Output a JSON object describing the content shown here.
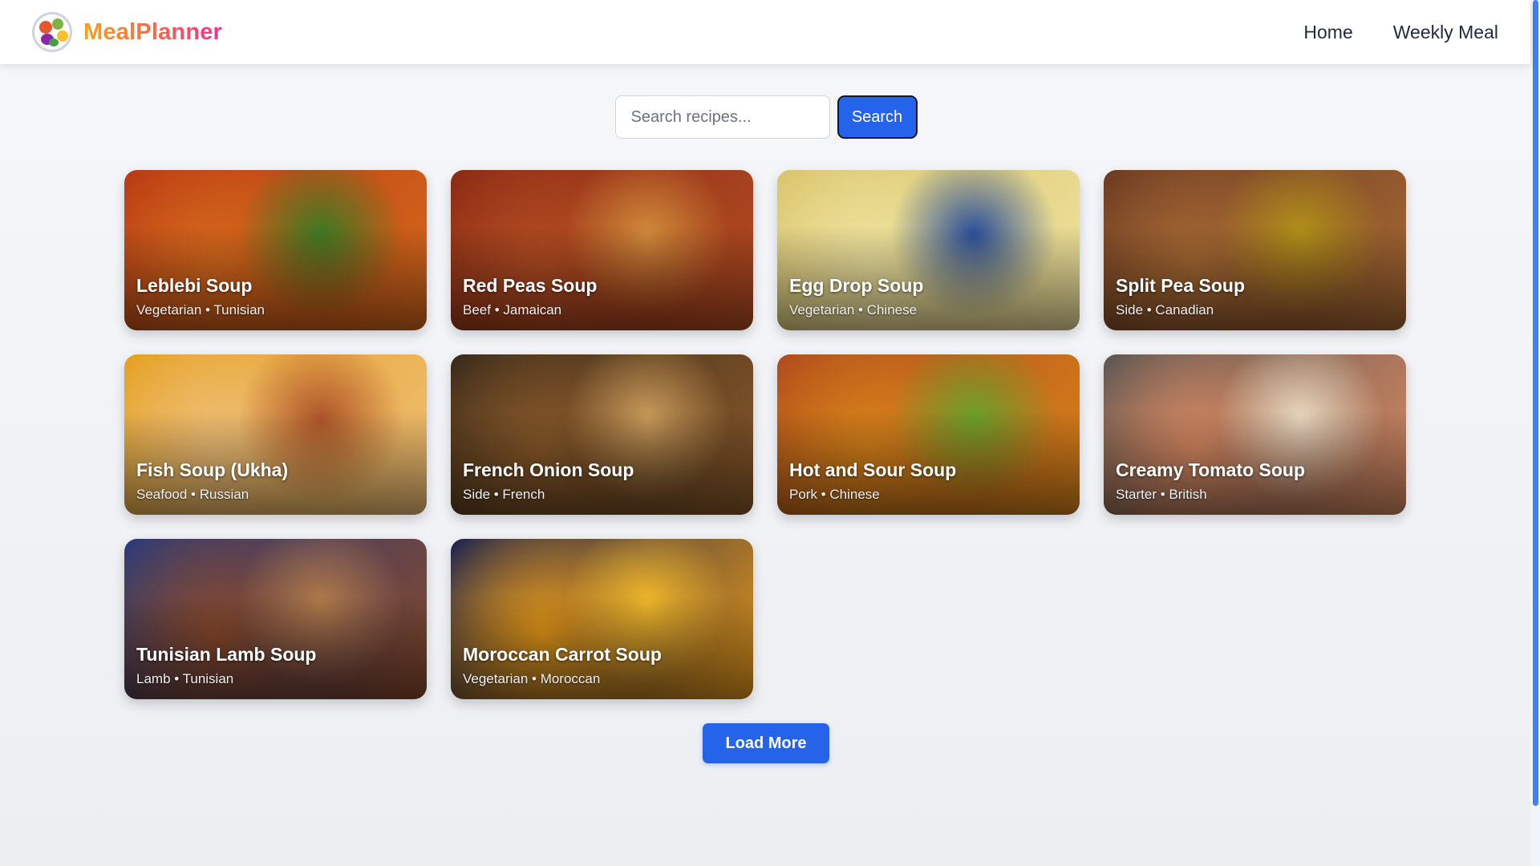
{
  "header": {
    "brand": "MealPlanner",
    "nav": [
      "Home",
      "Weekly Meal"
    ]
  },
  "search": {
    "placeholder": "Search recipes...",
    "button_label": "Search"
  },
  "recipes": [
    {
      "title": "Leblebi Soup",
      "meta": "Vegetarian • Tunisian",
      "colors": [
        "#b83a14",
        "#d66a1c",
        "#3d7a22"
      ]
    },
    {
      "title": "Red Peas Soup",
      "meta": "Beef • Jamaican",
      "colors": [
        "#8a2a14",
        "#b44d22",
        "#d08a3a"
      ]
    },
    {
      "title": "Egg Drop Soup",
      "meta": "Vegetarian • Chinese",
      "colors": [
        "#d8c46a",
        "#efe3a0",
        "#2a4f9a"
      ]
    },
    {
      "title": "Split Pea Soup",
      "meta": "Side • Canadian",
      "colors": [
        "#6a3a22",
        "#a86a34",
        "#b09018"
      ]
    },
    {
      "title": "Fish Soup (Ukha)",
      "meta": "Seafood • Russian",
      "colors": [
        "#e4a020",
        "#f0c07a",
        "#b0552a"
      ]
    },
    {
      "title": "French Onion Soup",
      "meta": "Side • French",
      "colors": [
        "#3a2a1a",
        "#8a5a2a",
        "#c89a5a"
      ]
    },
    {
      "title": "Hot and Sour Soup",
      "meta": "Pork • Chinese",
      "colors": [
        "#b04a1c",
        "#d8841a",
        "#6aa02a"
      ]
    },
    {
      "title": "Creamy Tomato Soup",
      "meta": "Starter • British",
      "colors": [
        "#5a5552",
        "#d98a62",
        "#e8d8c0"
      ]
    },
    {
      "title": "Tunisian Lamb Soup",
      "meta": "Lamb • Tunisian",
      "colors": [
        "#2a3a7a",
        "#8a4a2a",
        "#b07a4a"
      ]
    },
    {
      "title": "Moroccan Carrot Soup",
      "meta": "Vegetarian • Moroccan",
      "colors": [
        "#1a2250",
        "#e89a18",
        "#f0b82a"
      ]
    }
  ],
  "load_more_label": "Load More",
  "colors": {
    "accent": "#2563eb",
    "brand_gradient": [
      "#f6a21b",
      "#e8368f"
    ]
  }
}
